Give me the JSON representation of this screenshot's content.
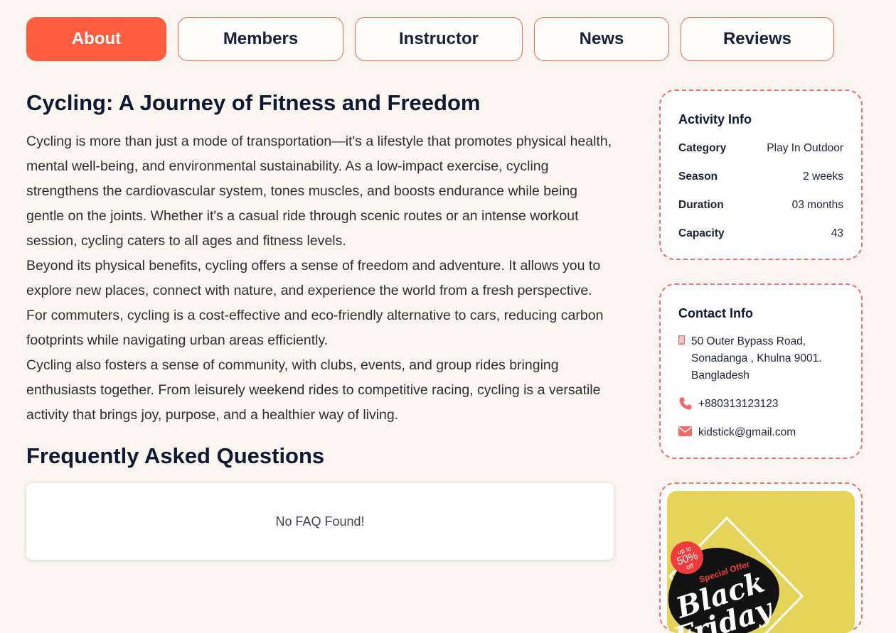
{
  "tabs": [
    {
      "label": "About",
      "active": true
    },
    {
      "label": "Members"
    },
    {
      "label": "Instructor"
    },
    {
      "label": "News"
    },
    {
      "label": "Reviews"
    }
  ],
  "article": {
    "title": "Cycling: A Journey of Fitness and Freedom",
    "paragraphs": [
      "Cycling is more than just a mode of transportation—it's a lifestyle that promotes physical health, mental well-being, and environmental sustainability. As a low-impact exercise, cycling strengthens the cardiovascular system, tones muscles, and boosts endurance while being gentle on the joints. Whether it's a casual ride through scenic routes or an intense workout session, cycling caters to all ages and fitness levels.",
      "Beyond its physical benefits, cycling offers a sense of freedom and adventure. It allows you to explore new places, connect with nature, and experience the world from a fresh perspective. For commuters, cycling is a cost-effective and eco-friendly alternative to cars, reducing carbon footprints while navigating urban areas efficiently.",
      "Cycling also fosters a sense of community, with clubs, events, and group rides bringing enthusiasts together. From leisurely weekend rides to competitive racing, cycling is a versatile activity that brings joy, purpose, and a healthier way of living."
    ]
  },
  "faq": {
    "title": "Frequently Asked Questions",
    "empty_text": "No FAQ Found!"
  },
  "activity_info": {
    "title": "Activity Info",
    "rows": [
      {
        "key": "Category",
        "value": "Play In Outdoor"
      },
      {
        "key": "Season",
        "value": "2 weeks"
      },
      {
        "key": "Duration",
        "value": "03 months"
      },
      {
        "key": "Capacity",
        "value": "43"
      }
    ]
  },
  "contact_info": {
    "title": "Contact Info",
    "address": "50 Outer Bypass Road, Sonadanga , Khulna 9001. Bangladesh",
    "phone": "+880313123123",
    "email": "kidstick@gmail.com"
  },
  "promo": {
    "badge_top": "up to",
    "badge_percent": "50%",
    "badge_bottom": "off",
    "special": "Special Offer",
    "headline_1": "Black",
    "headline_2": "Friday"
  },
  "colors": {
    "accent": "#ff5c40",
    "card_border": "#f07070",
    "background": "#faf5ee",
    "promo_bg": "#e6d35a"
  }
}
